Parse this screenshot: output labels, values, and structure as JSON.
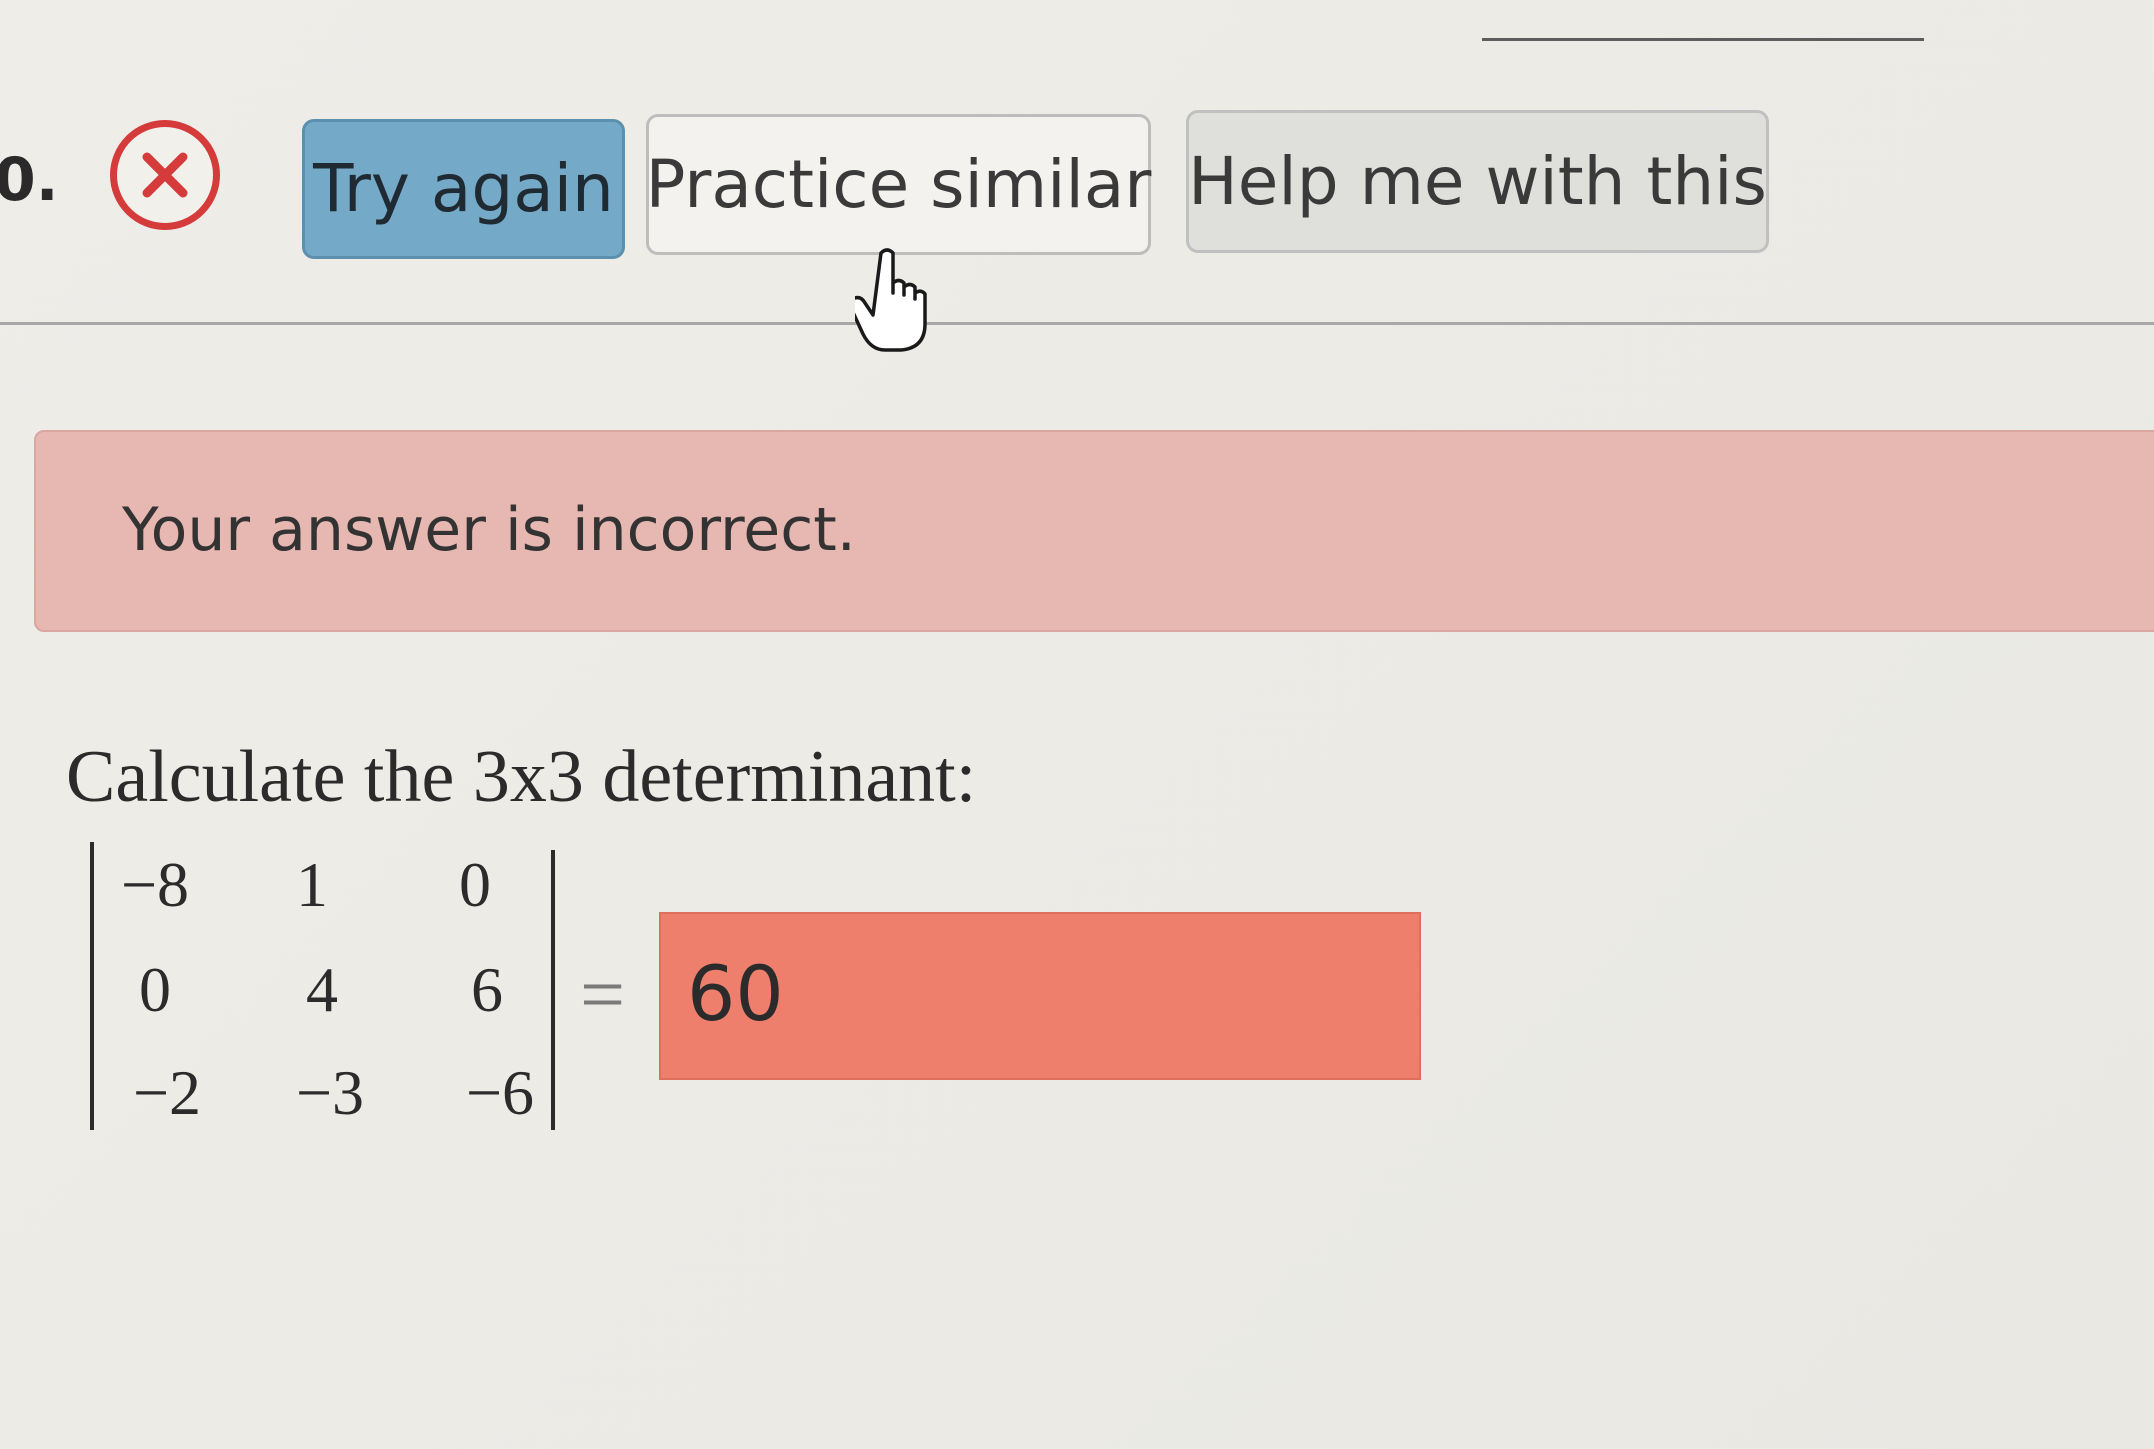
{
  "question_number": "0.",
  "status_icon": "incorrect-x-icon",
  "buttons": {
    "try_again": "Try again",
    "practice_similar": "Practice similar",
    "help": "Help me with this"
  },
  "feedback": {
    "message": "Your answer is incorrect."
  },
  "problem": {
    "prompt": "Calculate the 3x3 determinant:",
    "matrix": [
      [
        "−8",
        "1",
        "0"
      ],
      [
        "0",
        "4",
        "6"
      ],
      [
        "−2",
        "−3",
        "−6"
      ]
    ],
    "equals": "=",
    "answer_value": "60"
  },
  "colors": {
    "try_again_bg": "#74a9c8",
    "feedback_bg": "#e7b7b1",
    "answer_bg": "#ee7f6c",
    "incorrect_icon": "#d53b3b"
  }
}
